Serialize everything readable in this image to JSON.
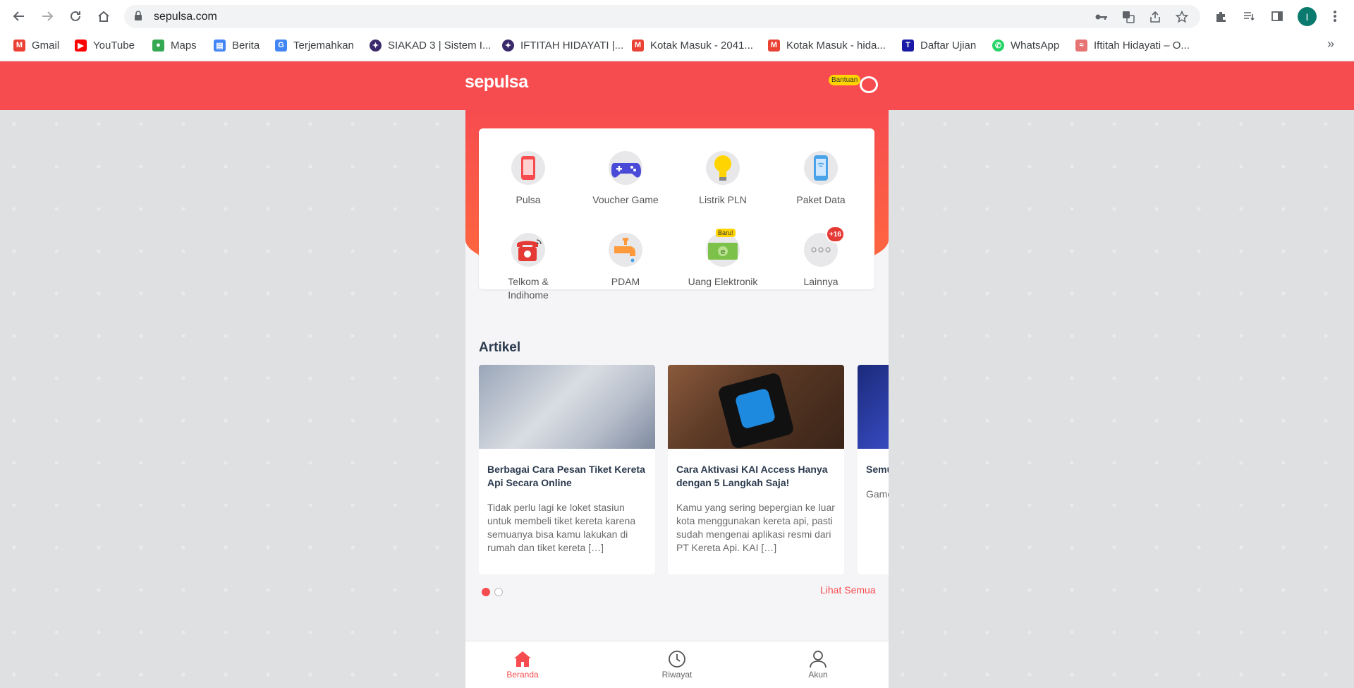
{
  "browser": {
    "url": "sepulsa.com",
    "avatar_letter": "I",
    "bookmarks": [
      {
        "label": "Gmail",
        "icon": "gmail-icon",
        "color": "#ea4335"
      },
      {
        "label": "YouTube",
        "icon": "youtube-icon",
        "color": "#ff0000"
      },
      {
        "label": "Maps",
        "icon": "maps-icon",
        "color": "#34a853"
      },
      {
        "label": "Berita",
        "icon": "news-icon",
        "color": "#4285f4"
      },
      {
        "label": "Terjemahkan",
        "icon": "translate-icon",
        "color": "#4285f4"
      },
      {
        "label": "SIAKAD 3 | Sistem I...",
        "icon": "siakad-icon",
        "color": "#3b2a6b"
      },
      {
        "label": "IFTITAH HIDAYATI |...",
        "icon": "iftitah-icon",
        "color": "#3b2a6b"
      },
      {
        "label": "Kotak Masuk - 2041...",
        "icon": "gmail-icon",
        "color": "#ea4335"
      },
      {
        "label": "Kotak Masuk - hida...",
        "icon": "gmail-icon",
        "color": "#ea4335"
      },
      {
        "label": "Daftar Ujian",
        "icon": "te-icon",
        "color": "#1a1aa6"
      },
      {
        "label": "WhatsApp",
        "icon": "whatsapp-icon",
        "color": "#25d366"
      },
      {
        "label": "Iftitah Hidayati – O...",
        "icon": "blog-icon",
        "color": "#e57373"
      }
    ]
  },
  "site": {
    "logo": "sepulsa",
    "help_label": "Bantuan",
    "brand_color": "#f74c4f",
    "menu": [
      {
        "label": "Pulsa",
        "icon": "phone-icon"
      },
      {
        "label": "Voucher Game",
        "icon": "gamepad-icon"
      },
      {
        "label": "Listrik PLN",
        "icon": "lightbulb-icon"
      },
      {
        "label": "Paket Data",
        "icon": "data-phone-icon"
      },
      {
        "label": "Telkom &\nIndihome",
        "icon": "telephone-icon"
      },
      {
        "label": "PDAM",
        "icon": "water-tap-icon"
      },
      {
        "label": "Uang Elektronik",
        "icon": "e-money-icon",
        "badge": "Baru!"
      },
      {
        "label": "Lainnya",
        "icon": "more-icon",
        "badge": "+16"
      }
    ],
    "articles_title": "Artikel",
    "articles": [
      {
        "title": "Berbagai Cara Pesan Tiket Kereta Api Secara Online",
        "desc": "Tidak perlu lagi ke loket stasiun untuk membeli tiket kereta karena semuanya bisa kamu lakukan di rumah dan tiket kereta […]"
      },
      {
        "title": "Cara Aktivasi KAI Access Hanya dengan 5 Langkah Saja!",
        "desc": "Kamu yang sering bepergian ke luar kota menggunakan kereta api, pasti sudah mengenai aplikasi resmi dari PT Kereta Api. KAI […]"
      },
      {
        "title": "Semu Uang",
        "desc": "Game perm masy perm"
      }
    ],
    "see_all": "Lihat Semua",
    "bottom_nav": [
      {
        "label": "Beranda",
        "icon": "home-icon"
      },
      {
        "label": "Riwayat",
        "icon": "clock-icon"
      },
      {
        "label": "Akun",
        "icon": "user-icon"
      }
    ]
  }
}
